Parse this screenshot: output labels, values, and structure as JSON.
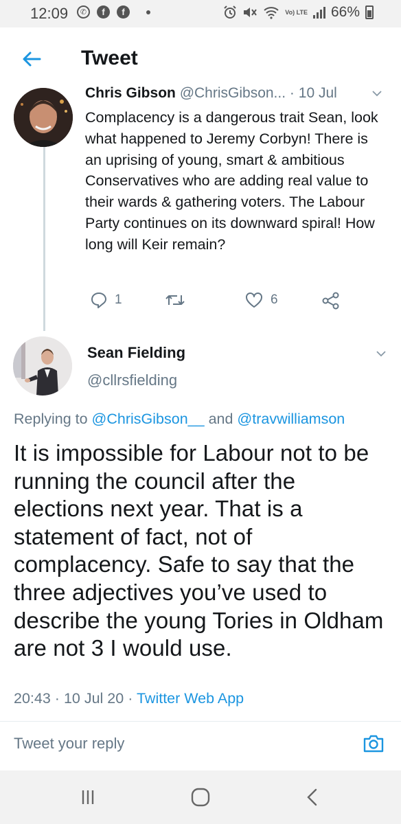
{
  "status_bar": {
    "time": "12:09",
    "notification_icons": [
      "whatsapp-icon",
      "facebook-icon",
      "facebook-icon"
    ],
    "network": "Vo) LTE",
    "battery": "66%"
  },
  "header": {
    "title": "Tweet"
  },
  "parent_tweet": {
    "name": "Chris Gibson",
    "handle": "@ChrisGibson...",
    "separator": "·",
    "date": "10 Jul",
    "text": "Complacency is a dangerous trait Sean, look what happened to Jeremy Corbyn! There is an uprising of young, smart & ambitious Conservatives who are adding real value to their wards & gathering voters. The Labour Party continues on its downward spiral! How long will Keir remain?",
    "replies": "1",
    "retweets": "",
    "likes": "6"
  },
  "main_tweet": {
    "name": "Sean Fielding",
    "handle": "@cllrsfielding",
    "replying_prefix": "Replying to ",
    "mention_1": "@ChrisGibson__",
    "replying_and": " and ",
    "mention_2": "@travwilliamson",
    "text": "It is impossible for Labour not to be running the council after the elections next year. That is a statement of fact, not of complacency. Safe to say that the three adjectives you’ve used to describe the young Tories in Oldham are not 3 I would use.",
    "time": "20:43",
    "separator": "·",
    "date": "10 Jul 20",
    "source": "Twitter Web App"
  },
  "composer": {
    "placeholder": "Tweet your reply"
  },
  "colors": {
    "accent": "#1b95e0",
    "secondary_text": "#657786",
    "primary_text": "#14171a"
  }
}
